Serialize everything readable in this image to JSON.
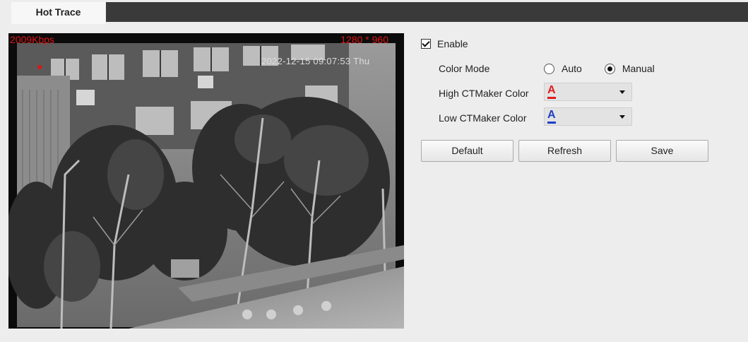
{
  "tabs": {
    "active_label": "Hot Trace"
  },
  "preview": {
    "bitrate": "2009Kbps",
    "resolution": "1280 * 960",
    "timestamp": "2022-12-15 09:07:53 Thu"
  },
  "settings": {
    "enable_label": "Enable",
    "enable_checked": true,
    "color_mode_label": "Color Mode",
    "color_mode_options": [
      "Auto",
      "Manual"
    ],
    "color_mode_selected": "Manual",
    "high_label": "High CTMaker Color",
    "high_value": "A",
    "high_color": "#e01d1d",
    "low_label": "Low CTMaker Color",
    "low_value": "A",
    "low_color": "#1f3fc4"
  },
  "buttons": {
    "default_label": "Default",
    "refresh_label": "Refresh",
    "save_label": "Save"
  }
}
